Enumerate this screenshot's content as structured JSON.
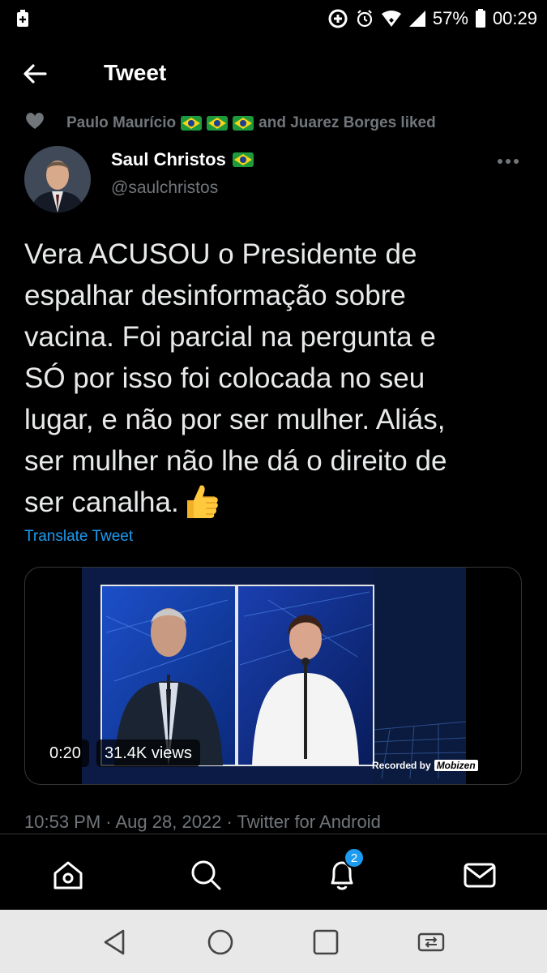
{
  "status_bar": {
    "battery_percent": "57%",
    "time": "00:29",
    "icons": [
      "plus-box-icon",
      "data-saver-icon",
      "alarm-icon",
      "wifi-icon",
      "signal-icon",
      "battery-icon"
    ]
  },
  "header": {
    "title": "Tweet",
    "back_icon": "arrow-left-icon"
  },
  "social_context": {
    "first_liker": "Paulo Maurício",
    "rest": "and Juarez Borges liked",
    "icon": "heart-icon"
  },
  "author": {
    "name": "Saul Christos",
    "handle": "@saulchristos",
    "flag_icon": "brazil-flag-icon"
  },
  "tweet": {
    "text": "Vera ACUSOU o Presidente de\nespalhar desinformação sobre\nvacina. Foi parcial na pergunta e\nSÓ por isso foi colocada no seu\nlugar, e não por ser mulher. Aliás,\nser mulher não lhe dá o direito de\nser canalha.",
    "emoji": "thumbs-up-icon",
    "translate_label": "Translate Tweet"
  },
  "media": {
    "duration": "0:20",
    "views": "31.4K views",
    "watermark_prefix": "Recorded by",
    "watermark_brand": "Mobizen"
  },
  "timestamp": "10:53 PM · Aug 28, 2022 · Twitter for Android",
  "bottom_nav": {
    "items": [
      "home-icon",
      "search-icon",
      "notifications-icon",
      "messages-icon"
    ],
    "notification_count": "2"
  },
  "colors": {
    "background": "#000000",
    "text": "#e7e9ea",
    "secondary": "#71767b",
    "link": "#1d9bf0"
  }
}
